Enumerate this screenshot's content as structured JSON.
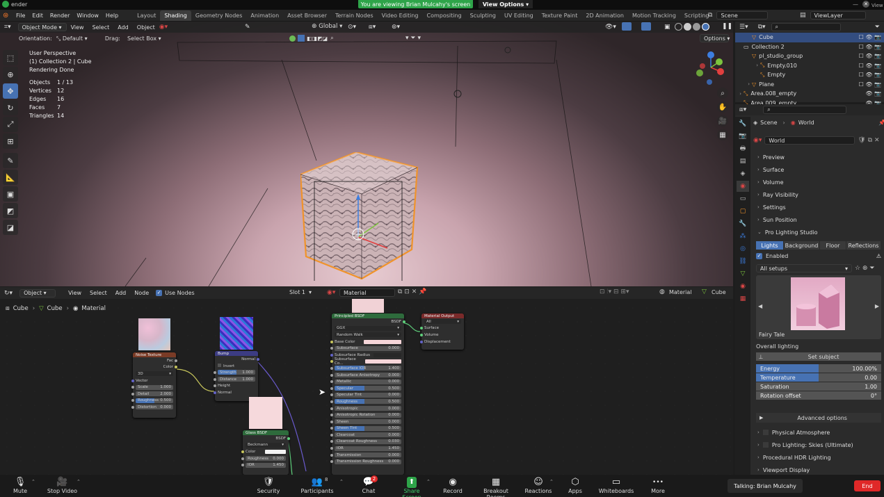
{
  "window": {
    "title": "ender",
    "banner": "You are viewing Brian Mulcahy's screen",
    "view_options": "View Options",
    "corner_view": "View"
  },
  "menu": [
    "File",
    "Edit",
    "Render",
    "Window",
    "Help"
  ],
  "workspaces": [
    "Layout",
    "Shading",
    "Geometry Nodes",
    "Animation",
    "Asset Browser",
    "Terrain Nodes",
    "Video Editing",
    "Compositing",
    "Sculpting",
    "UV Editing",
    "Texture Paint",
    "2D Animation",
    "Motion Tracking",
    "Scripting"
  ],
  "active_workspace": "Shading",
  "scene_name": "Scene",
  "view_layer": "ViewLayer",
  "viewport": {
    "header": {
      "mode": "Object Mode",
      "items": [
        "View",
        "Select",
        "Add",
        "Object"
      ],
      "transform": "Global"
    },
    "header2": {
      "orientation_label": "Orientation:",
      "orientation_value": "Default",
      "drag_label": "Drag:",
      "drag_value": "Select Box",
      "options": "Options"
    },
    "overlay": {
      "line1": "User Perspective",
      "line2": "(1) Collection 2 | Cube",
      "line3": "Rendering Done"
    },
    "stats": [
      {
        "label": "Objects",
        "value": "1 / 13"
      },
      {
        "label": "Vertices",
        "value": "12"
      },
      {
        "label": "Edges",
        "value": "16"
      },
      {
        "label": "Faces",
        "value": "7"
      },
      {
        "label": "Triangles",
        "value": "14"
      }
    ]
  },
  "node_editor": {
    "header": {
      "mode": "Object",
      "items": [
        "View",
        "Select",
        "Add",
        "Node"
      ],
      "use_nodes": "Use Nodes",
      "slot": "Slot 1",
      "material": "Material",
      "right_material": "Material",
      "right_object": "Cube"
    },
    "breadcrumb": [
      "Cube",
      "Cube",
      "Material"
    ],
    "noise": {
      "title": "Noise Texture",
      "out1": "Fac",
      "out2": "Color",
      "dim": "3D",
      "vector": "Vector",
      "fields": [
        {
          "label": "Scale",
          "value": "1.000"
        },
        {
          "label": "Detail",
          "value": "2.000"
        },
        {
          "label": "Roughness",
          "value": "0.500"
        },
        {
          "label": "Distortion",
          "value": "0.000"
        }
      ]
    },
    "bump": {
      "title": "Bump",
      "out": "Normal",
      "invert": "Invert",
      "fields": [
        {
          "label": "Strength",
          "value": "1.000"
        },
        {
          "label": "Distance",
          "value": "1.000"
        }
      ],
      "in1": "Height",
      "in2": "Normal"
    },
    "glass": {
      "title": "Glass BSDF",
      "out": "BSDF",
      "dist": "Beckmann",
      "fields": [
        {
          "label": "Color",
          "value": ""
        },
        {
          "label": "Roughness",
          "value": "0.000"
        },
        {
          "label": "IOR",
          "value": "1.450"
        }
      ]
    },
    "principled": {
      "title": "Principled BSDF",
      "out": "BSDF",
      "dist": "GGX",
      "sss": "Random Walk",
      "fields": [
        {
          "label": "Base Color",
          "value": ""
        },
        {
          "label": "Subsurface",
          "value": "0.000"
        },
        {
          "label": "Subsurface Radius",
          "value": ""
        },
        {
          "label": "Subsurface Co...",
          "value": ""
        },
        {
          "label": "Subsurface IOR",
          "value": "1.400"
        },
        {
          "label": "Subsurface Anisotropy",
          "value": "0.000"
        },
        {
          "label": "Metallic",
          "value": "0.000"
        },
        {
          "label": "Specular",
          "value": "0.500"
        },
        {
          "label": "Specular Tint",
          "value": "0.000"
        },
        {
          "label": "Roughness",
          "value": "0.500"
        },
        {
          "label": "Anisotropic",
          "value": "0.000"
        },
        {
          "label": "Anisotropic Rotation",
          "value": "0.000"
        },
        {
          "label": "Sheen",
          "value": "0.000"
        },
        {
          "label": "Sheen Tint",
          "value": "0.500"
        },
        {
          "label": "Clearcoat",
          "value": "0.000"
        },
        {
          "label": "Clearcoat Roughness",
          "value": "0.030"
        },
        {
          "label": "IOR",
          "value": "1.450"
        },
        {
          "label": "Transmission",
          "value": "0.000"
        },
        {
          "label": "Transmission Roughness",
          "value": "0.000"
        }
      ]
    },
    "output": {
      "title": "Material Output",
      "target": "All",
      "inputs": [
        "Surface",
        "Volume",
        "Displacement"
      ]
    }
  },
  "outliner": [
    {
      "name": "Cube",
      "indent": 1,
      "selected": true
    },
    {
      "name": "Collection 2",
      "indent": 0,
      "selected": false
    },
    {
      "name": "pl_studio_group",
      "indent": 1,
      "selected": false
    },
    {
      "name": "Empty.010",
      "indent": 2,
      "selected": false
    },
    {
      "name": "Empty",
      "indent": 2,
      "selected": false
    },
    {
      "name": "Plane",
      "indent": 1,
      "selected": false
    },
    {
      "name": "Area.008_empty",
      "indent": 0,
      "selected": false
    },
    {
      "name": "Area.009_empty",
      "indent": 0,
      "selected": false
    }
  ],
  "properties": {
    "breadcrumb": [
      "Scene",
      "World"
    ],
    "world_name": "World",
    "panels": [
      "Preview",
      "Surface",
      "Volume",
      "Ray Visibility",
      "Settings",
      "Sun Position",
      "Pro Lighting Studio"
    ],
    "pls_tabs": [
      "Lights",
      "Background",
      "Floor",
      "Reflections"
    ],
    "enabled": "Enabled",
    "setups": "All setups",
    "preview_label": "Fairy Tale",
    "overall": "Overall lighting",
    "set_subject": "Set subject",
    "sliders": [
      {
        "label": "Energy",
        "value": "100.00%",
        "fill": 0.5
      },
      {
        "label": "Temperature",
        "value": "0.00",
        "fill": 0.5
      },
      {
        "label": "Saturation",
        "value": "1.00",
        "fill": 0
      },
      {
        "label": "Rotation offset",
        "value": "0°",
        "fill": 0
      }
    ],
    "advanced": "Advanced options",
    "bottom_panels": [
      "Physical Atmosphere",
      "Pro Lighting: Skies (Ultimate)",
      "Procedural HDR Lighting",
      "Viewport Display"
    ]
  },
  "zoom": {
    "buttons": [
      {
        "label": "Mute",
        "icon": "🎙"
      },
      {
        "label": "Stop Video",
        "icon": "🎥"
      },
      {
        "label": "Security",
        "icon": "🛡"
      },
      {
        "label": "Participants",
        "icon": "👥"
      },
      {
        "label": "Chat",
        "icon": "💬"
      },
      {
        "label": "Share Screen",
        "icon": "⬆"
      },
      {
        "label": "Record",
        "icon": "◉"
      },
      {
        "label": "Breakout Rooms",
        "icon": "▦"
      },
      {
        "label": "Reactions",
        "icon": "☺"
      },
      {
        "label": "Apps",
        "icon": "⬡"
      },
      {
        "label": "Whiteboards",
        "icon": "▭"
      },
      {
        "label": "More",
        "icon": "•••"
      }
    ],
    "participants_count": "8",
    "chat_badge": "2",
    "talking": "Talking: Brian Mulcahy",
    "end": "End"
  },
  "colors": {
    "accent": "#4772b3",
    "selection_outline": "#f0932b",
    "zoom_green": "#2ea449",
    "end_red": "#e02828"
  }
}
